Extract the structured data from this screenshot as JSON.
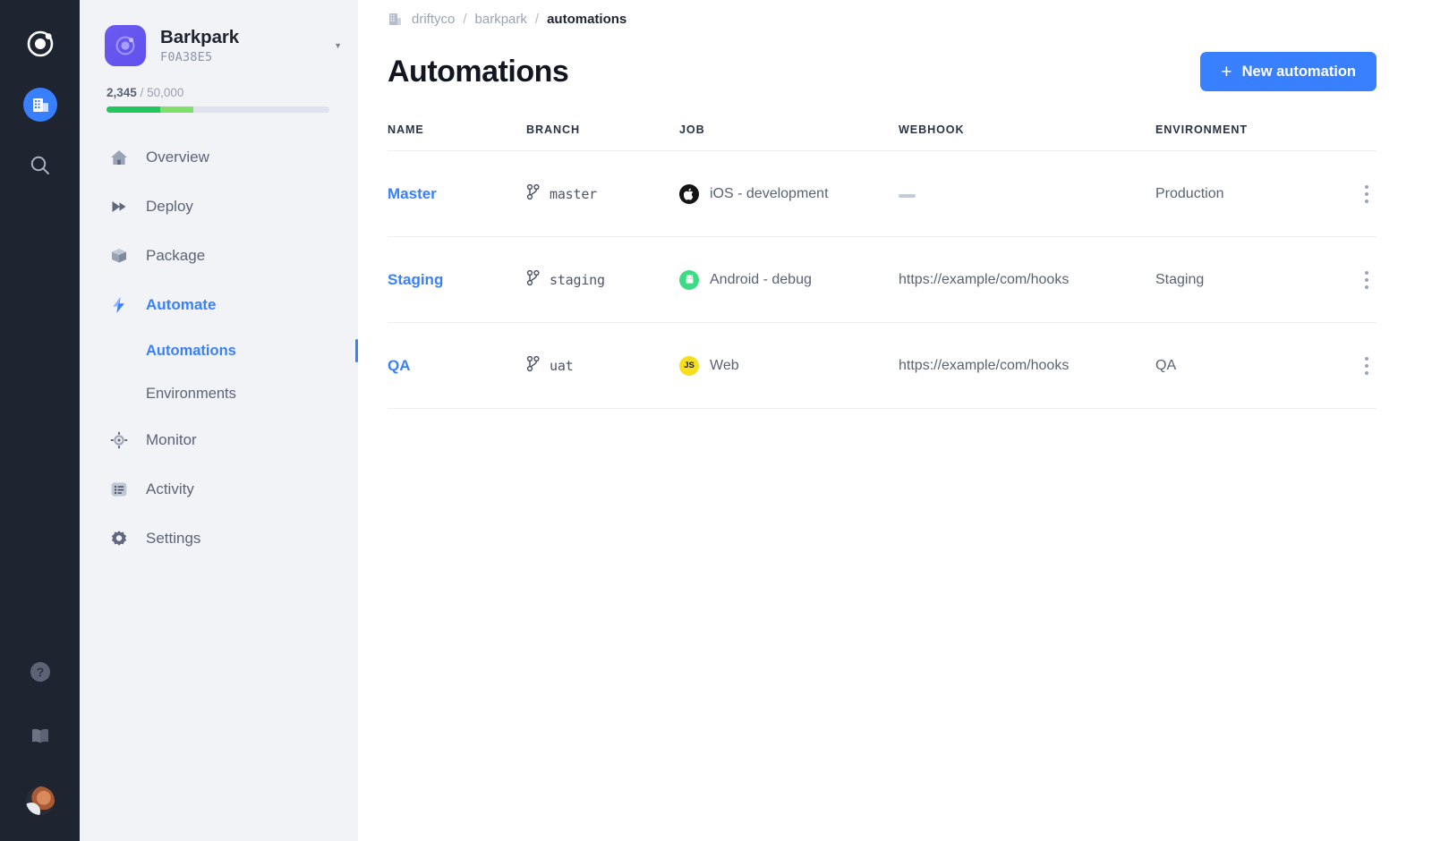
{
  "rail": {
    "logo": "ionic-logo-icon",
    "items": [
      {
        "name": "org-switcher-building-icon",
        "label": "Organization"
      },
      {
        "name": "search-icon",
        "label": "Search"
      }
    ],
    "bottom": [
      {
        "name": "help-icon",
        "label": "Help"
      },
      {
        "name": "docs-book-icon",
        "label": "Docs"
      },
      {
        "name": "user-avatar",
        "label": "Account"
      }
    ]
  },
  "sidebar": {
    "org": {
      "name": "Barkpark",
      "id": "F0A38E5",
      "caret": "▾"
    },
    "usage": {
      "used": "2,345",
      "separator": "/",
      "total": "50,000",
      "segment1_pct": 24,
      "segment2_pct": 15,
      "color_used": "#23c65c",
      "color_used_light": "#7de06a",
      "color_track": "#dfe3ee"
    },
    "nav": [
      {
        "label": "Overview",
        "icon": "home-icon",
        "active": false
      },
      {
        "label": "Deploy",
        "icon": "play-icon",
        "active": false
      },
      {
        "label": "Package",
        "icon": "box-icon",
        "active": false
      },
      {
        "label": "Automate",
        "icon": "bolt-icon",
        "active": true
      }
    ],
    "sub_nav": [
      {
        "label": "Automations",
        "active": true
      },
      {
        "label": "Environments",
        "active": false
      }
    ],
    "nav_lower": [
      {
        "label": "Monitor",
        "icon": "crosshair-icon",
        "active": false
      },
      {
        "label": "Activity",
        "icon": "list-icon",
        "active": false
      },
      {
        "label": "Settings",
        "icon": "gear-icon",
        "active": false
      }
    ]
  },
  "main": {
    "breadcrumb": {
      "icon": "building-icon",
      "items": [
        "driftyco",
        "barkpark",
        "automations"
      ],
      "separator": "/"
    },
    "title": "Automations",
    "new_button": {
      "label": "New automation",
      "plus": "+",
      "color": "#3880ff"
    },
    "table": {
      "columns": [
        "NAME",
        "BRANCH",
        "JOB",
        "WEBHOOK",
        "ENVIRONMENT"
      ],
      "rows": [
        {
          "name": "Master",
          "branch": "master",
          "job": "iOS - development",
          "job_icon": "apple-icon",
          "webhook": "—",
          "webhook_empty": true,
          "environment": "Production"
        },
        {
          "name": "Staging",
          "branch": "staging",
          "job": "Android - debug",
          "job_icon": "android-icon",
          "webhook": "https://example/com/hooks",
          "webhook_empty": false,
          "environment": "Staging"
        },
        {
          "name": "QA",
          "branch": "uat",
          "job": "Web",
          "job_icon": "js-icon",
          "webhook": "https://example/com/hooks",
          "webhook_empty": false,
          "environment": "QA"
        }
      ],
      "row_menu_label": "⋮"
    }
  }
}
